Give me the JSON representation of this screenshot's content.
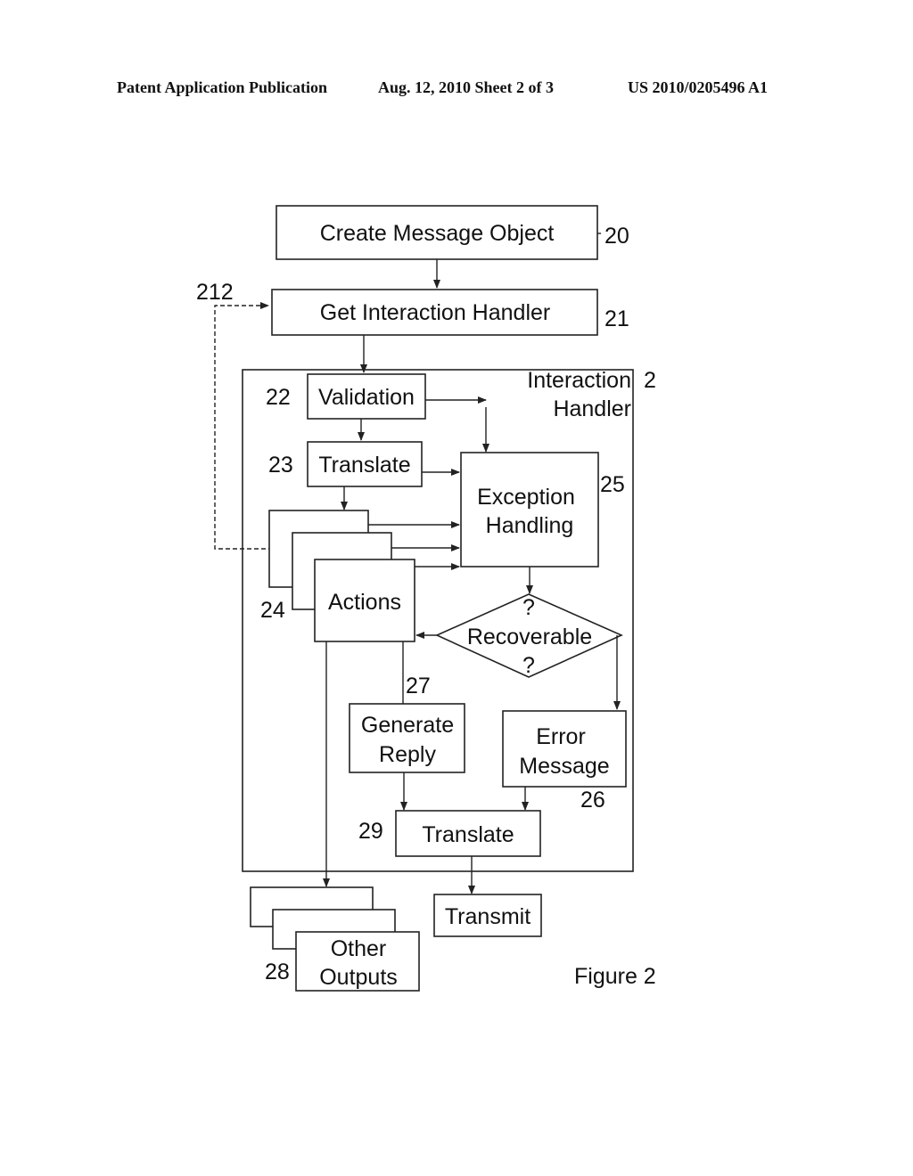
{
  "header": {
    "left": "Patent Application Publication",
    "middle": "Aug. 12, 2010  Sheet 2 of 3",
    "right": "US 2010/0205496 A1"
  },
  "diagram": {
    "figure_label": "Figure 2",
    "nodes": {
      "create_message": {
        "label": "Create Message Object",
        "ref": "20"
      },
      "get_handler": {
        "label": "Get Interaction Handler",
        "ref": "21"
      },
      "handler_group": {
        "label_line1": "Interaction",
        "label_line2": "Handler",
        "ref": "2"
      },
      "validation": {
        "label": "Validation",
        "ref": "22"
      },
      "translate_in": {
        "label": "Translate",
        "ref": "23"
      },
      "exception": {
        "label_line1": "Exception",
        "label_line2": "Handling",
        "ref": "25"
      },
      "actions": {
        "label": "Actions",
        "ref": "24"
      },
      "recoverable": {
        "q_top": "?",
        "label": "Recoverable",
        "q_bottom": "?"
      },
      "generate_reply": {
        "label_line1": "Generate",
        "label_line2": "Reply",
        "ref": "27"
      },
      "error_message": {
        "label_line1": "Error",
        "label_line2": "Message",
        "ref": "26"
      },
      "translate_out": {
        "label": "Translate",
        "ref": "29"
      },
      "transmit": {
        "label": "Transmit"
      },
      "other_outputs": {
        "label_line1": "Other",
        "label_line2": "Outputs",
        "ref": "28"
      },
      "loop_ref": "212"
    },
    "edges": [
      {
        "from": "create_message",
        "to": "get_handler",
        "style": "solid"
      },
      {
        "from": "get_handler",
        "to": "validation",
        "style": "solid"
      },
      {
        "from": "validation",
        "to": "translate_in",
        "style": "solid"
      },
      {
        "from": "validation",
        "to": "exception",
        "style": "solid"
      },
      {
        "from": "translate_in",
        "to": "actions",
        "style": "solid"
      },
      {
        "from": "translate_in",
        "to": "exception",
        "style": "solid"
      },
      {
        "from": "actions",
        "to": "exception",
        "style": "solid"
      },
      {
        "from": "exception",
        "to": "recoverable",
        "style": "solid"
      },
      {
        "from": "recoverable",
        "to": "actions",
        "style": "solid"
      },
      {
        "from": "recoverable",
        "to": "error_message",
        "style": "solid"
      },
      {
        "from": "actions",
        "to": "generate_reply",
        "style": "solid"
      },
      {
        "from": "actions",
        "to": "other_outputs",
        "style": "solid"
      },
      {
        "from": "generate_reply",
        "to": "translate_out",
        "style": "solid"
      },
      {
        "from": "error_message",
        "to": "translate_out",
        "style": "solid"
      },
      {
        "from": "translate_out",
        "to": "transmit",
        "style": "solid"
      },
      {
        "from": "actions",
        "to": "get_handler",
        "style": "dashed",
        "ref": "212"
      }
    ]
  }
}
